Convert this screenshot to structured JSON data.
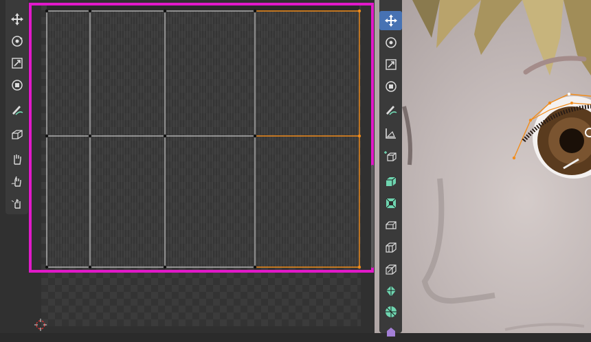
{
  "uv_editor": {
    "tools": [
      {
        "name": "move",
        "icon": "move-icon",
        "active": false
      },
      {
        "name": "rotate",
        "icon": "rotate-icon",
        "active": false
      },
      {
        "name": "scale",
        "icon": "scale-icon",
        "active": false
      },
      {
        "name": "transform",
        "icon": "transform-icon",
        "active": false
      },
      {
        "name": "annotate",
        "icon": "annotate-icon",
        "active": false
      },
      {
        "name": "rip-region",
        "icon": "rip-region-icon",
        "active": false
      },
      {
        "name": "grab",
        "icon": "grab-icon",
        "active": false
      },
      {
        "name": "relax",
        "icon": "relax-icon",
        "active": false
      },
      {
        "name": "pinch",
        "icon": "pinch-icon",
        "active": false
      }
    ],
    "colors": {
      "selection_frame": "#e119c9",
      "selected_edge": "#f28c1a",
      "active_tool": "#4772b3"
    }
  },
  "viewport_3d": {
    "tools": [
      {
        "name": "move",
        "icon": "move-icon",
        "active": true
      },
      {
        "name": "rotate",
        "icon": "rotate-icon",
        "active": false
      },
      {
        "name": "scale",
        "icon": "scale-icon",
        "active": false
      },
      {
        "name": "transform",
        "icon": "transform-icon",
        "active": false
      },
      {
        "name": "annotate",
        "icon": "annotate-icon",
        "active": false
      },
      {
        "name": "measure",
        "icon": "measure-icon",
        "active": false
      },
      {
        "name": "add-cube",
        "icon": "add-cube-icon",
        "active": false
      },
      {
        "name": "extrude",
        "icon": "extrude-icon",
        "active": false
      },
      {
        "name": "inset",
        "icon": "inset-icon",
        "active": false
      },
      {
        "name": "bevel",
        "icon": "bevel-icon",
        "active": false
      },
      {
        "name": "loop-cut",
        "icon": "loop-cut-icon",
        "active": false
      },
      {
        "name": "knife",
        "icon": "knife-icon",
        "active": false
      },
      {
        "name": "poly-build",
        "icon": "poly-build-icon",
        "active": false
      },
      {
        "name": "spin",
        "icon": "spin-icon",
        "active": false
      },
      {
        "name": "smooth",
        "icon": "smooth-icon",
        "active": false
      }
    ]
  }
}
